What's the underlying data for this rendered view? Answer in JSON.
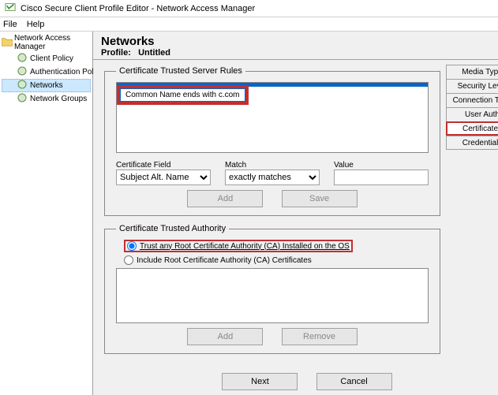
{
  "window": {
    "title": "Cisco Secure Client Profile Editor - Network Access Manager"
  },
  "menu": {
    "file": "File",
    "help": "Help"
  },
  "tree": {
    "root": "Network Access Manager",
    "items": [
      {
        "label": "Client Policy"
      },
      {
        "label": "Authentication Policy"
      },
      {
        "label": "Networks",
        "selected": true
      },
      {
        "label": "Network Groups"
      }
    ]
  },
  "header": {
    "title": "Networks",
    "profile_label": "Profile:",
    "profile_value": "Untitled"
  },
  "rules_group": {
    "legend": "Certificate Trusted Server Rules",
    "rule0": "Common Name ends with c.com",
    "cert_field_label": "Certificate Field",
    "cert_field_value": "Subject Alt. Name",
    "match_label": "Match",
    "match_value": "exactly matches",
    "value_label": "Value",
    "value_input": "",
    "add_btn": "Add",
    "save_btn": "Save"
  },
  "authority_group": {
    "legend": "Certificate Trusted Authority",
    "opt_trust_os": "Trust any Root Certificate Authority (CA) Installed on the OS",
    "opt_include": "Include Root Certificate Authority (CA) Certificates",
    "add_btn": "Add",
    "remove_btn": "Remove"
  },
  "nav": {
    "next": "Next",
    "cancel": "Cancel"
  },
  "tabs": {
    "media": "Media Type",
    "security": "Security Level",
    "connection": "Connection Type",
    "userauth": "User Auth",
    "certificates": "Certificates",
    "credentials": "Credentials"
  }
}
